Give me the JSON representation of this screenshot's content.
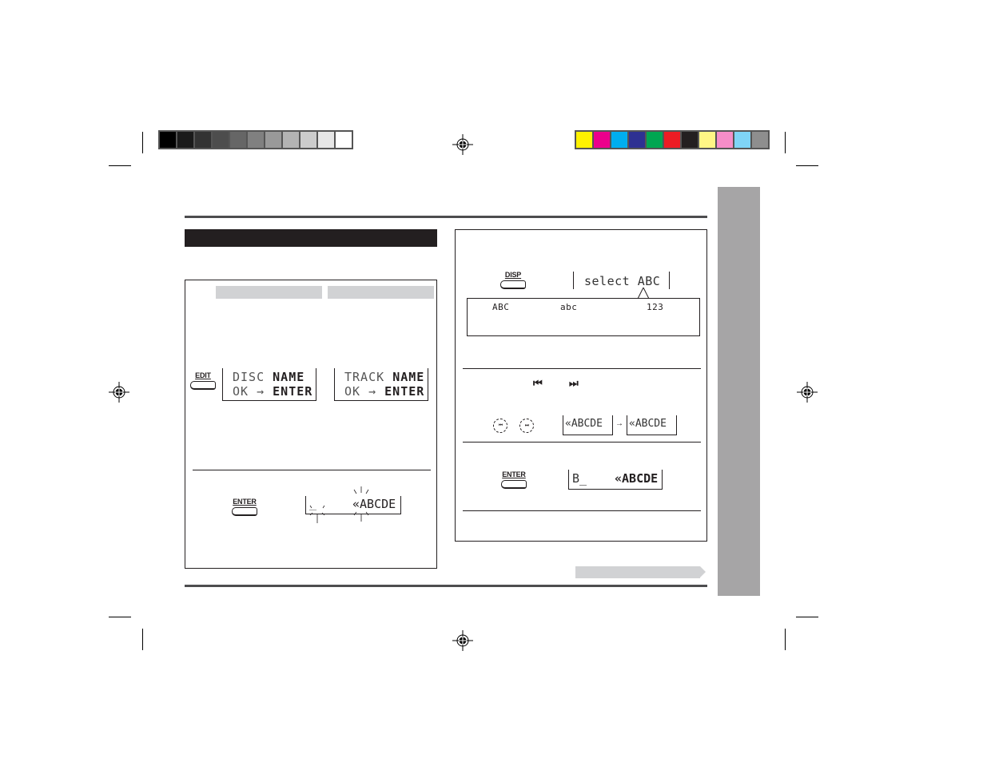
{
  "print_marks": {
    "grayscale_swatches": [
      "#000000",
      "#1a1a1a",
      "#333333",
      "#4d4d4d",
      "#666666",
      "#808080",
      "#999999",
      "#b3b3b3",
      "#cccccc",
      "#e6e6e6",
      "#ffffff"
    ],
    "color_swatches": [
      "#fff200",
      "#ec008c",
      "#00aeef",
      "#2e3192",
      "#00a651",
      "#ed1c24",
      "#231f20",
      "#fff685",
      "#f68dc8",
      "#7fd4f6",
      "#8e8e8e"
    ]
  },
  "left_panel": {
    "tab_labels": [
      "",
      ""
    ],
    "edit_button": {
      "label": "EDIT"
    },
    "disc_display": {
      "line1_dim": "DISC ",
      "line1_bold": "NAME",
      "line2_dim": "OK → ",
      "line2_bold": "ENTER"
    },
    "track_display": {
      "line1_dim": "TRACK ",
      "line1_bold": "NAME",
      "line2_dim": "OK → ",
      "line2_bold": "ENTER"
    },
    "enter_button": {
      "label": "ENTER"
    },
    "enter_display": {
      "left": "_",
      "right": "«ABCDE"
    }
  },
  "right_panel": {
    "disp_button": {
      "label": "DISP"
    },
    "select_display": {
      "text": "select ABC"
    },
    "modes": [
      "ABC",
      "abc",
      "123"
    ],
    "skip_icons": {
      "prev": "⏮",
      "next": "⏭"
    },
    "circle_buttons": [
      "⏮",
      "⏭"
    ],
    "display_before": "«ABCDE",
    "arrow": "→",
    "display_after": "«ABCDE",
    "enter_button": {
      "label": "ENTER"
    },
    "enter_display": {
      "left": "B_",
      "right": "«ABCDE"
    }
  }
}
